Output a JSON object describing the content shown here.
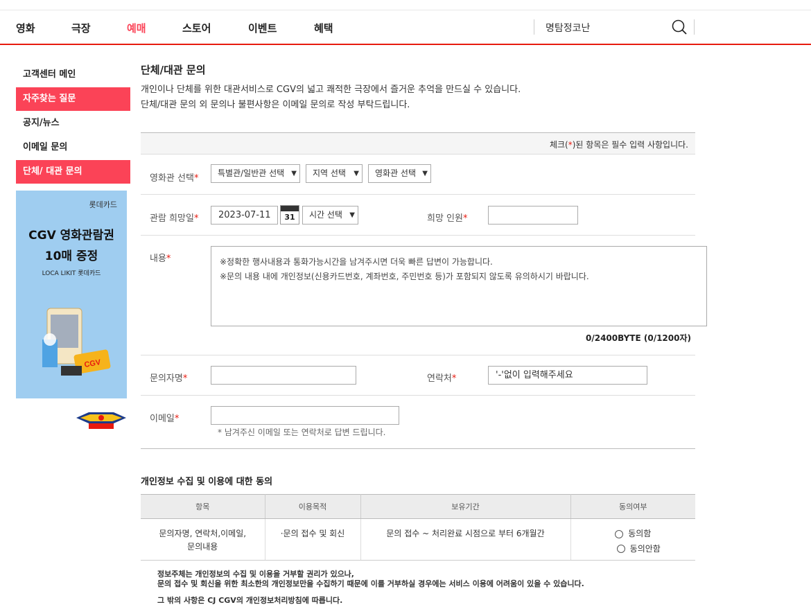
{
  "nav": {
    "items": [
      "영화",
      "극장",
      "예매",
      "스토어",
      "이벤트",
      "혜택"
    ],
    "active_index": 2,
    "search_value": "명탐정코난"
  },
  "sidebar": {
    "items": [
      {
        "label": "고객센터 메인",
        "active": false
      },
      {
        "label": "자주찾는 질문",
        "active": true
      },
      {
        "label": "공지/뉴스",
        "active": false
      },
      {
        "label": "이메일 문의",
        "active": false
      },
      {
        "label": "단체/ 대관 문의",
        "active": true
      }
    ],
    "banner": {
      "brand": "롯데카드",
      "line1": "CGV 영화관람권",
      "line2": "10매 증정",
      "line3": "LOCA LIKIT 롯데카드",
      "card_text": "CGV"
    }
  },
  "main": {
    "title": "단체/대관 문의",
    "desc1": "개인이나 단체를 위한 대관서비스로 CGV의 넓고 쾌적한 극장에서 즐거운 추억을 만드실 수 있습니다.",
    "desc2": "단체/대관 문의 외 문의나 불편사항은 이메일 문의로 작성 부탁드립니다.",
    "required_note_pre": "체크(",
    "required_note_star": "*",
    "required_note_post": ")된 항목은 필수 입력 사항입니다."
  },
  "form": {
    "theater_label": "영화관 선택",
    "theater_type": "특별관/일반관 선택",
    "region": "지역 선택",
    "theater": "영화관 선택",
    "date_label": "관람 희망일",
    "date_value": "2023-07-11",
    "calendar_day": "31",
    "time": "시간 선택",
    "people_label": "희망 인원",
    "people_value": "",
    "content_label": "내용",
    "content_line1": "※정확한 행사내용과 통화가능시간을 남겨주시면  더욱 빠른 답변이 가능합니다.",
    "content_line2": "※문의 내용 내에 개인정보(신용카드번호, 계좌번호, 주민번호 등)가 포함되지 않도록 유의하시기 바랍니다.",
    "byte_count": "0/2400BYTE (0/1200자)",
    "name_label": "문의자명",
    "name_value": "",
    "phone_label": "연락처",
    "phone_placeholder": "'-'없이 입력해주세요",
    "email_label": "이메일",
    "email_value": "",
    "email_hint": "* 남겨주신 이메일 또는 연락처로 답변 드립니다.",
    "star": "*"
  },
  "consent": {
    "title": "개인정보 수집 및 이용에 대한 동의",
    "headers": [
      "항목",
      "이용목적",
      "보유기간",
      "동의여부"
    ],
    "item_line1": "문의자명, 연락처,이메일,",
    "item_line2": "문의내용",
    "purpose": "·문의 접수 및 회신",
    "period": "문의 접수 ~ 처리완료 시점으로 부터 6개월간",
    "agree": "동의함",
    "disagree": "동의안함",
    "notice1": "정보주체는 개인정보의 수집 및 이용을 거부할 권리가 있으나,",
    "notice2": "문의 접수 및 회신을 위한 최소한의 개인정보만을 수집하기 때문에 이를 거부하실 경우에는 서비스 이용에 어려움이 있을 수 있습니다.",
    "notice3": "그 밖의 사항은 CJ CGV의 개인정보처리방침에 따릅니다."
  },
  "colors": {
    "accent": "#fb4357",
    "nav_line": "#e71a0f",
    "banner_bg": "#9fcdf0"
  }
}
